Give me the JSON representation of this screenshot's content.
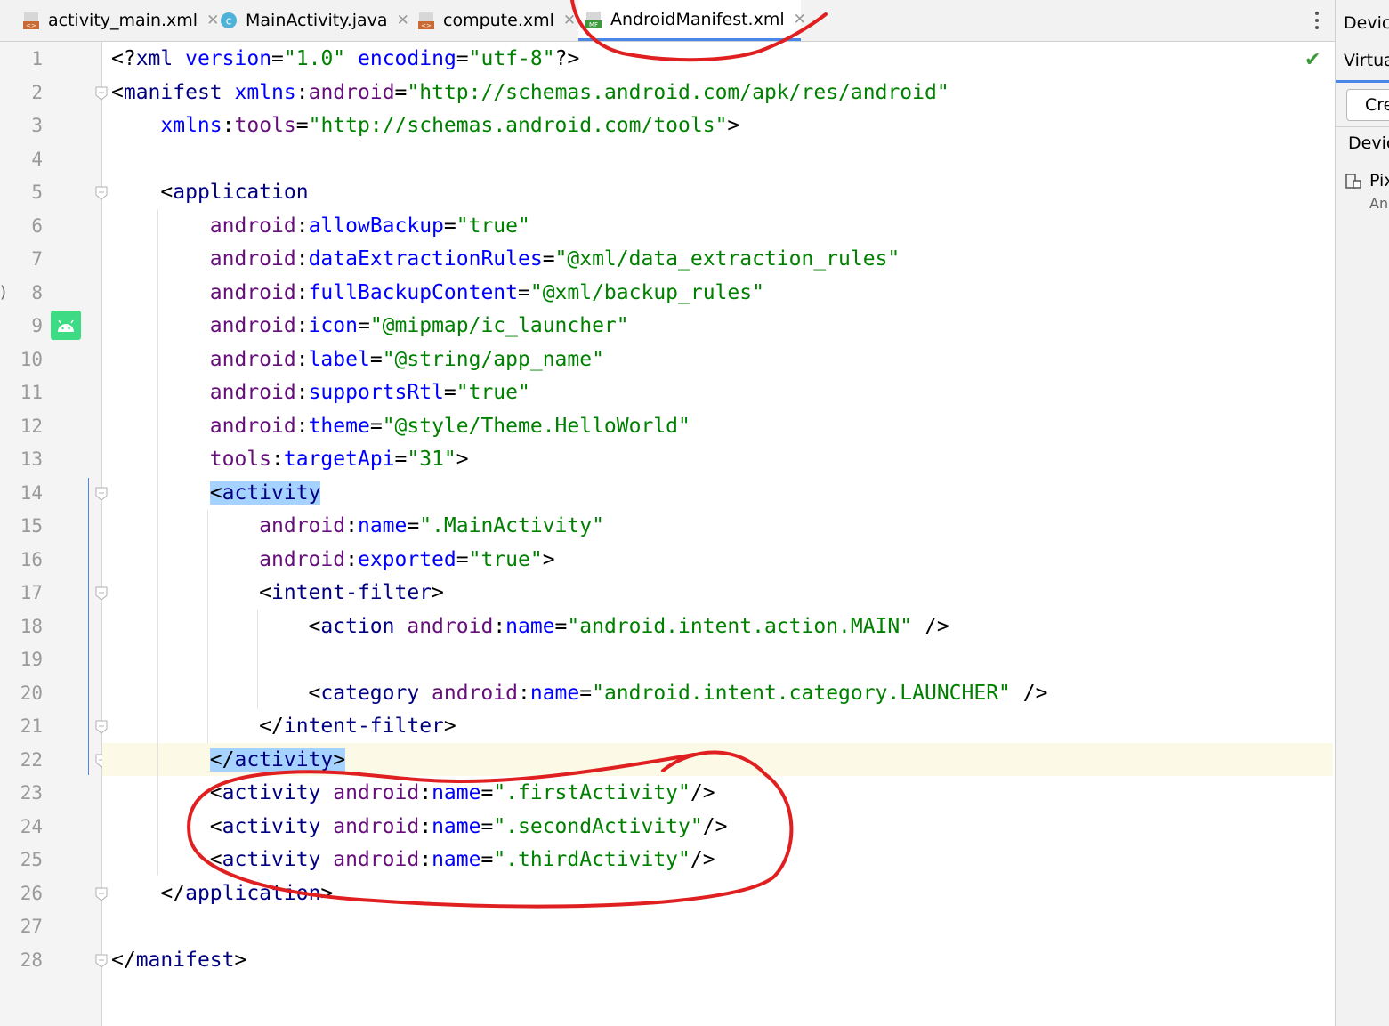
{
  "tabs": [
    {
      "label": "activity_main.xml",
      "icon": "xml-layout-icon",
      "active": false
    },
    {
      "label": "MainActivity.java",
      "icon": "java-class-icon",
      "active": false
    },
    {
      "label": "compute.xml",
      "icon": "xml-layout-icon",
      "active": false
    },
    {
      "label": "AndroidManifest.xml",
      "icon": "manifest-icon",
      "active": true
    }
  ],
  "gutter": {
    "line_numbers": [
      "1",
      "2",
      "3",
      "4",
      "5",
      "6",
      "7",
      "8",
      "9",
      "10",
      "11",
      "12",
      "13",
      "14",
      "15",
      "16",
      "17",
      "18",
      "19",
      "20",
      "21",
      "22",
      "23",
      "24",
      "25",
      "26",
      "27",
      "28"
    ],
    "current_line": "22",
    "icons": [
      "android-icon",
      "check-icon"
    ]
  },
  "code": {
    "l1": {
      "a": "<?",
      "b": "xml",
      "c": " ",
      "d": "version",
      "e": "=",
      "f": "\"1.0\"",
      "g": " ",
      "h": "encoding",
      "i": "=",
      "j": "\"utf-8\"",
      "k": "?>"
    },
    "l2": {
      "a": "<",
      "b": "manifest",
      "c": " ",
      "d": "xmlns",
      "e": ":",
      "f": "android",
      "g": "=",
      "h": "\"http://schemas.android.com/apk/res/android\""
    },
    "l3": {
      "a": "    ",
      "b": "xmlns",
      "c": ":",
      "d": "tools",
      "e": "=",
      "f": "\"http://schemas.android.com/tools\"",
      "g": ">"
    },
    "l5": {
      "a": "    <",
      "b": "application"
    },
    "l6": {
      "a": "        ",
      "b": "android",
      "c": ":",
      "d": "allowBackup",
      "e": "=",
      "f": "\"true\""
    },
    "l7": {
      "a": "        ",
      "b": "android",
      "c": ":",
      "d": "dataExtractionRules",
      "e": "=",
      "f": "\"@xml/data_extraction_rules\""
    },
    "l8": {
      "a": "        ",
      "b": "android",
      "c": ":",
      "d": "fullBackupContent",
      "e": "=",
      "f": "\"@xml/backup_rules\""
    },
    "l9": {
      "a": "        ",
      "b": "android",
      "c": ":",
      "d": "icon",
      "e": "=",
      "f": "\"@mipmap/ic_launcher\""
    },
    "l10": {
      "a": "        ",
      "b": "android",
      "c": ":",
      "d": "label",
      "e": "=",
      "f": "\"@string/app_name\""
    },
    "l11": {
      "a": "        ",
      "b": "android",
      "c": ":",
      "d": "supportsRtl",
      "e": "=",
      "f": "\"true\""
    },
    "l12": {
      "a": "        ",
      "b": "android",
      "c": ":",
      "d": "theme",
      "e": "=",
      "f": "\"@style/Theme.HelloWorld\""
    },
    "l13": {
      "a": "        ",
      "b": "tools",
      "c": ":",
      "d": "targetApi",
      "e": "=",
      "f": "\"31\"",
      "g": ">"
    },
    "l14": {
      "a": "        ",
      "b": "<",
      "c": "activity"
    },
    "l15": {
      "a": "            ",
      "b": "android",
      "c": ":",
      "d": "name",
      "e": "=",
      "f": "\".MainActivity\""
    },
    "l16": {
      "a": "            ",
      "b": "android",
      "c": ":",
      "d": "exported",
      "e": "=",
      "f": "\"true\"",
      "g": ">"
    },
    "l17": {
      "a": "            <",
      "b": "intent-filter",
      "c": ">"
    },
    "l18": {
      "a": "                <",
      "b": "action",
      "c": " ",
      "d": "android",
      "e": ":",
      "f": "name",
      "g": "=",
      "h": "\"android.intent.action.MAIN\"",
      "i": " />"
    },
    "l20": {
      "a": "                <",
      "b": "category",
      "c": " ",
      "d": "android",
      "e": ":",
      "f": "name",
      "g": "=",
      "h": "\"android.intent.category.LAUNCHER\"",
      "i": " />"
    },
    "l21": {
      "a": "            </",
      "b": "intent-filter",
      "c": ">"
    },
    "l22": {
      "a": "        ",
      "b": "</",
      "c": "activity",
      "d": ">"
    },
    "l23": {
      "a": "        <",
      "b": "activity",
      "c": " ",
      "d": "android",
      "e": ":",
      "f": "name",
      "g": "=",
      "h": "\".firstActivity\"",
      "i": "/>"
    },
    "l24": {
      "a": "        <",
      "b": "activity",
      "c": " ",
      "d": "android",
      "e": ":",
      "f": "name",
      "g": "=",
      "h": "\".secondActivity\"",
      "i": "/>"
    },
    "l25": {
      "a": "        <",
      "b": "activity",
      "c": " ",
      "d": "android",
      "e": ":",
      "f": "name",
      "g": "=",
      "h": "\".thirdActivity\"",
      "i": "/>"
    },
    "l26": {
      "a": "    </",
      "b": "application",
      "c": ">"
    },
    "l28": {
      "a": "</",
      "b": "manifest",
      "c": ">"
    }
  },
  "right_panel": {
    "title": "Device",
    "tab": "Virtua",
    "button": "Cre",
    "column": "Devic",
    "row_name": "Pix",
    "row_sub": "An"
  },
  "colors": {
    "tag": "#000080",
    "attribute": "#660e7a",
    "namespace": "#0000ff",
    "value": "#008000",
    "selection": "#a6d2ff",
    "annotation": "#e02020",
    "accent": "#4a86e8"
  },
  "side_marker": ")"
}
